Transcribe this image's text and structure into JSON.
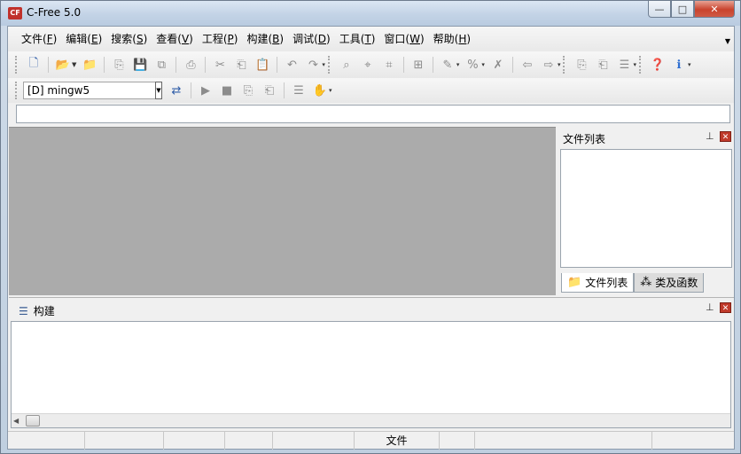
{
  "window": {
    "title": "C-Free 5.0",
    "app_icon": "CF"
  },
  "window_controls": {
    "minimize": "—",
    "maximize": "□",
    "close": "✕"
  },
  "menu": {
    "items": [
      {
        "label": "文件(",
        "key": "F",
        "tail": ")"
      },
      {
        "label": "编辑(",
        "key": "E",
        "tail": ")"
      },
      {
        "label": "搜索(",
        "key": "S",
        "tail": ")"
      },
      {
        "label": "查看(",
        "key": "V",
        "tail": ")"
      },
      {
        "label": "工程(",
        "key": "P",
        "tail": ")"
      },
      {
        "label": "构建(",
        "key": "B",
        "tail": ")"
      },
      {
        "label": "调试(",
        "key": "D",
        "tail": ")"
      },
      {
        "label": "工具(",
        "key": "T",
        "tail": ")"
      },
      {
        "label": "窗口(",
        "key": "W",
        "tail": ")"
      },
      {
        "label": "帮助(",
        "key": "H",
        "tail": ")"
      }
    ]
  },
  "toolbar": {
    "compiler_value": "[D] mingw5"
  },
  "files_panel": {
    "title": "文件列表",
    "tabs": [
      "文件列表",
      "类及函数"
    ]
  },
  "build_panel": {
    "title": "构建"
  },
  "status": {
    "cells": [
      "",
      "",
      "",
      "",
      "",
      "文件",
      "",
      "",
      ""
    ]
  }
}
